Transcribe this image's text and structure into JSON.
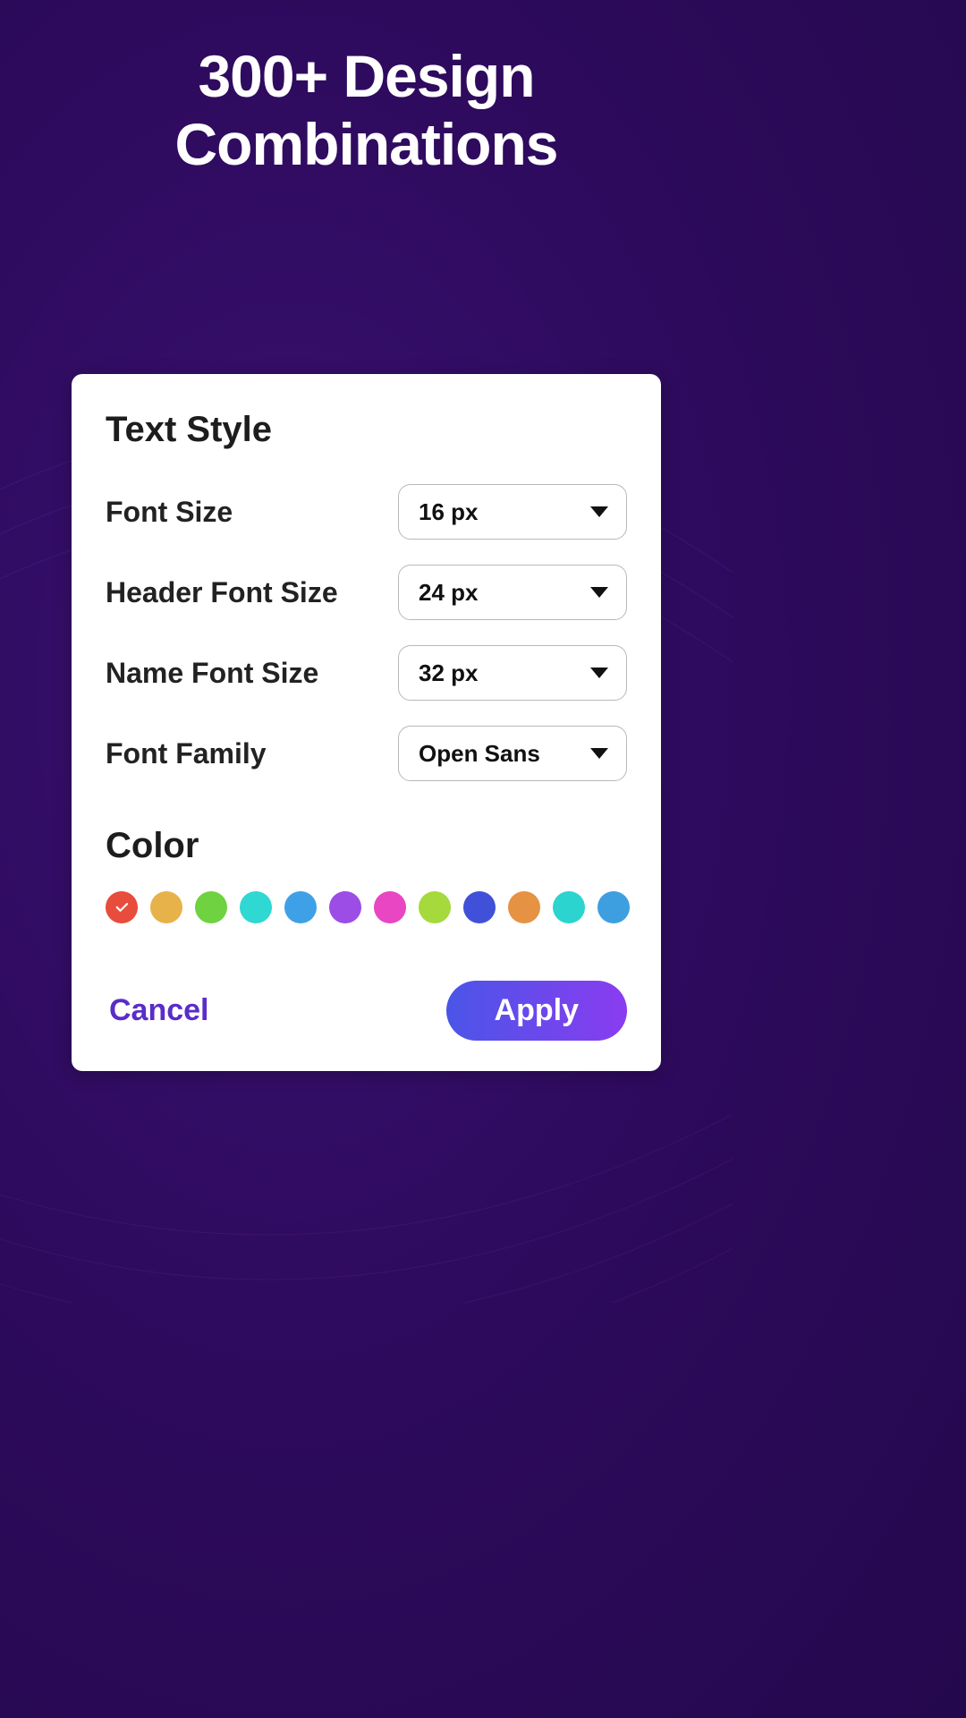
{
  "headline": "300+ Design Combinations",
  "card": {
    "text_style": {
      "title": "Text Style",
      "rows": [
        {
          "label": "Font Size",
          "value": "16 px"
        },
        {
          "label": "Header Font Size",
          "value": "24 px"
        },
        {
          "label": "Name Font Size",
          "value": "32 px"
        },
        {
          "label": "Font Family",
          "value": "Open Sans"
        }
      ]
    },
    "color": {
      "title": "Color",
      "swatches": [
        {
          "hex": "#e74c3c",
          "selected": true
        },
        {
          "hex": "#e7b24a",
          "selected": false
        },
        {
          "hex": "#6fd240",
          "selected": false
        },
        {
          "hex": "#2fd8d2",
          "selected": false
        },
        {
          "hex": "#3ea1e8",
          "selected": false
        },
        {
          "hex": "#9b4de6",
          "selected": false
        },
        {
          "hex": "#e846c2",
          "selected": false
        },
        {
          "hex": "#a6d93c",
          "selected": false
        },
        {
          "hex": "#4150d9",
          "selected": false
        },
        {
          "hex": "#e59242",
          "selected": false
        },
        {
          "hex": "#2bd4cf",
          "selected": false
        },
        {
          "hex": "#3d9fe0",
          "selected": false
        }
      ]
    },
    "actions": {
      "cancel": "Cancel",
      "apply": "Apply"
    }
  }
}
